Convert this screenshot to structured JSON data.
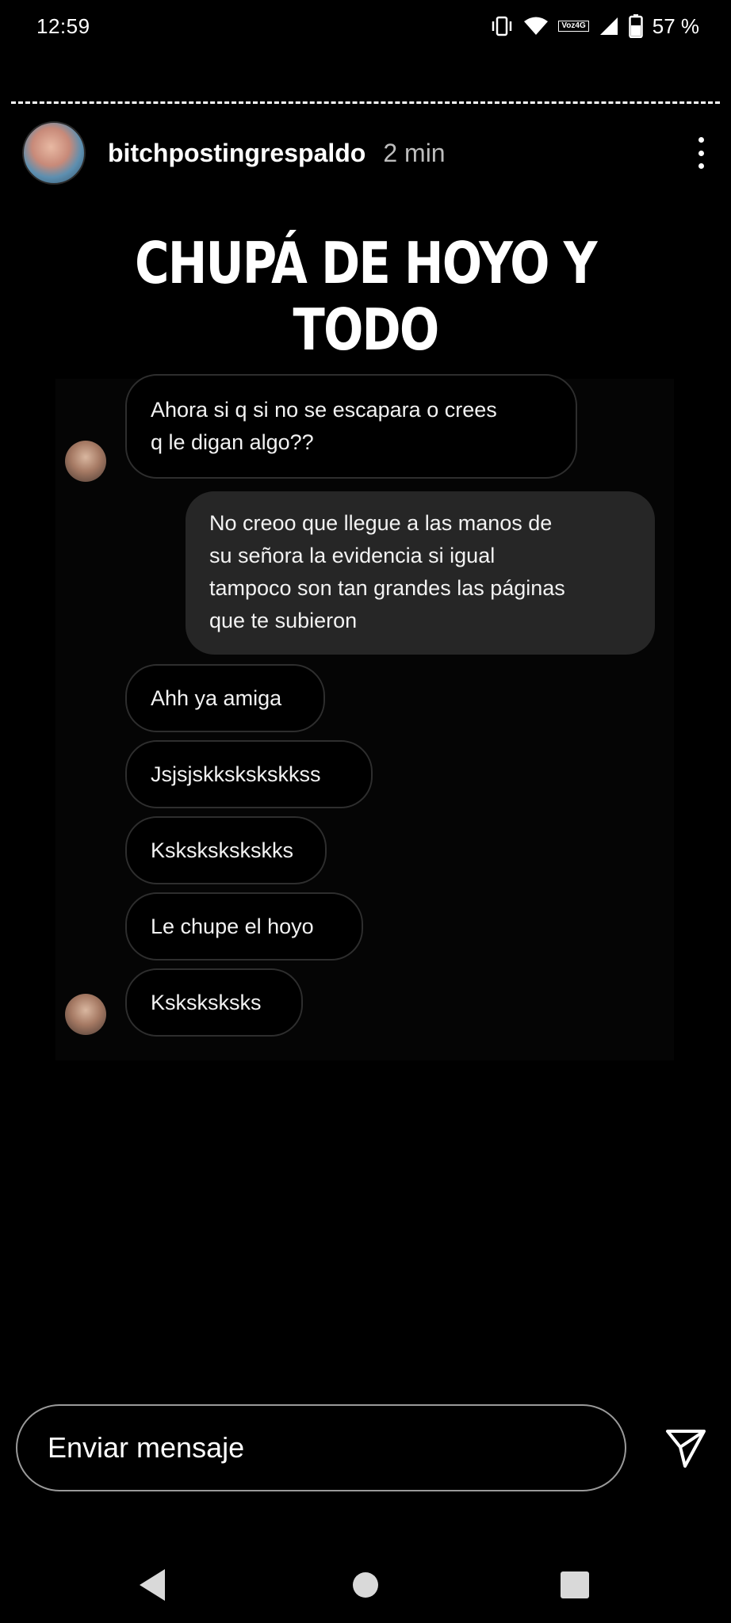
{
  "status_bar": {
    "time": "12:59",
    "network_label_top": "Voz",
    "network_label_bottom": "4G",
    "battery": "57 %"
  },
  "story": {
    "username": "bitchpostingrespaldo",
    "time_ago": "2 min",
    "headline": "CHUPÁ DE HOYO Y TODO"
  },
  "chat": {
    "messages": [
      {
        "side": "in",
        "text_1": "Ahora si q si no se escapara o crees",
        "text_2": "q le digan algo??"
      },
      {
        "side": "out",
        "lines": [
          "No creoo que llegue a las manos de",
          "su señora la evidencia si igual",
          "tampoco son tan grandes las páginas",
          "que te subieron"
        ]
      },
      {
        "side": "in",
        "text": "Ahh ya amiga"
      },
      {
        "side": "in",
        "text": "Jsjsjskkskskskkss"
      },
      {
        "side": "in",
        "text": "Kskskskskskks"
      },
      {
        "side": "in",
        "text": "Le chupe el hoyo"
      },
      {
        "side": "in",
        "text": "Ksksksksks"
      }
    ]
  },
  "composer": {
    "placeholder": "Enviar mensaje"
  },
  "icons": {
    "vibrate": "vibrate-icon",
    "wifi": "wifi-icon",
    "signal": "signal-icon",
    "battery": "battery-icon",
    "more": "more-vertical-icon",
    "send": "send-icon",
    "back": "back-icon",
    "home": "home-icon",
    "recents": "recents-icon"
  }
}
